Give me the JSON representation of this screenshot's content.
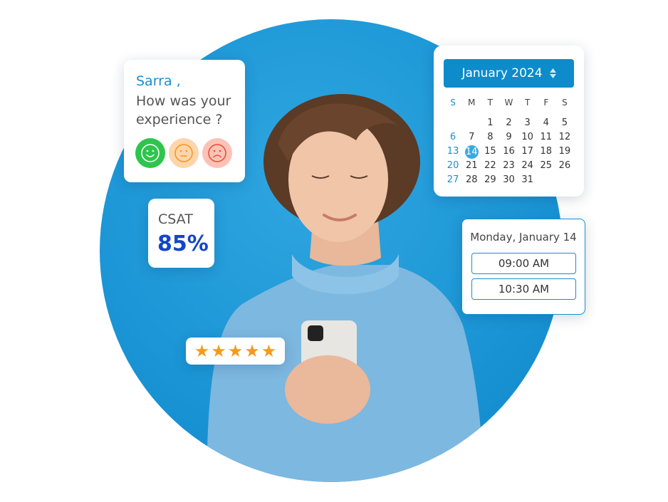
{
  "survey": {
    "name": "Sarra ,",
    "question": "How was your experience ?",
    "faces": [
      {
        "icon": "happy-face-icon",
        "color": "#2ec54d",
        "bg": "#2ec54d",
        "stroke": "#ffffff"
      },
      {
        "icon": "neutral-face-icon",
        "color": "#f39a1e",
        "bg": "#fdd5ac",
        "stroke": "#f39a1e"
      },
      {
        "icon": "sad-face-icon",
        "color": "#e8503a",
        "bg": "#fbc3b6",
        "stroke": "#e8503a"
      }
    ]
  },
  "csat": {
    "label": "CSAT",
    "value": "85%"
  },
  "rating": {
    "stars": 5,
    "max": 5,
    "icon": "star-icon"
  },
  "calendar": {
    "month_label": "January 2024",
    "sort_icon": "updown-arrow-icon",
    "weekdays": [
      "S",
      "M",
      "T",
      "W",
      "T",
      "F",
      "S"
    ],
    "weeks": [
      [
        "",
        "",
        "1",
        "2",
        "3",
        "4",
        "5"
      ],
      [
        "6",
        "7",
        "8",
        "9",
        "10",
        "11",
        "12"
      ],
      [
        "13",
        "14",
        "15",
        "16",
        "17",
        "18",
        "19"
      ],
      [
        "20",
        "21",
        "22",
        "23",
        "24",
        "25",
        "26"
      ],
      [
        "27",
        "28",
        "29",
        "30",
        "31",
        "",
        ""
      ]
    ],
    "selected": "14"
  },
  "booking": {
    "date": "Monday, January 14",
    "slots": [
      "09:00 AM",
      "10:30 AM"
    ]
  },
  "colors": {
    "brand": "#1a8fcf",
    "circle": "#1c96d6",
    "csat": "#1446c8",
    "star": "#f39a1e"
  }
}
